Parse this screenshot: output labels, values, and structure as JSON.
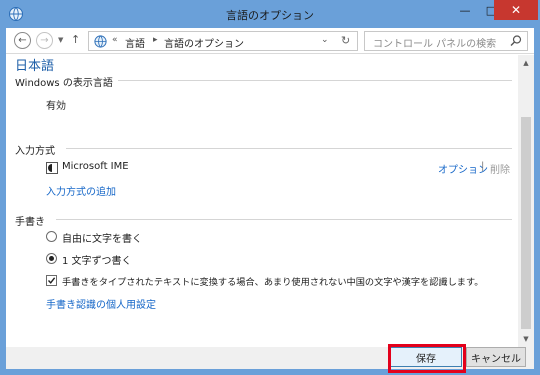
{
  "window": {
    "title": "言語のオプション",
    "controls": {
      "minimize": "—",
      "maximize": "□",
      "close": "✕"
    }
  },
  "navigation": {
    "back": "←",
    "forward": "→",
    "recent": "▼",
    "up": "↑",
    "breadcrumb_overflow": "«",
    "breadcrumb": [
      "言語",
      "言語のオプション"
    ],
    "crumb_separator": "▸",
    "address_dropdown": "⌄",
    "refresh": "↻",
    "search_placeholder": "コントロール パネルの検索"
  },
  "page": {
    "title": "日本語",
    "display_language": {
      "heading": "Windows の表示言語",
      "status": "有効"
    },
    "input_method": {
      "heading": "入力方式",
      "ime_name": "Microsoft IME",
      "options_link": "オプション",
      "separator": "|",
      "remove_label": "削除",
      "add_link": "入力方式の追加"
    },
    "handwriting": {
      "heading": "手書き",
      "radio_free": "自由に文字を書く",
      "radio_single": "1 文字ずつ書く",
      "radio_selected": "single",
      "checkbox_label": "手書きをタイプされたテキストに変換する場合、あまり使用されない中国の文字や漢字を認識します。",
      "checkbox_checked": true,
      "personalize_link": "手書き認識の個人用設定"
    }
  },
  "footer": {
    "save_label": "保存",
    "cancel_label": "キャンセル"
  },
  "scrollbar": {
    "up": "▲",
    "down": "▼"
  },
  "colors": {
    "frame": "#6aa0d9",
    "link": "#1667c8",
    "title": "#1e5fa8",
    "highlight": "#e3001b",
    "close_button": "#c7372f"
  }
}
